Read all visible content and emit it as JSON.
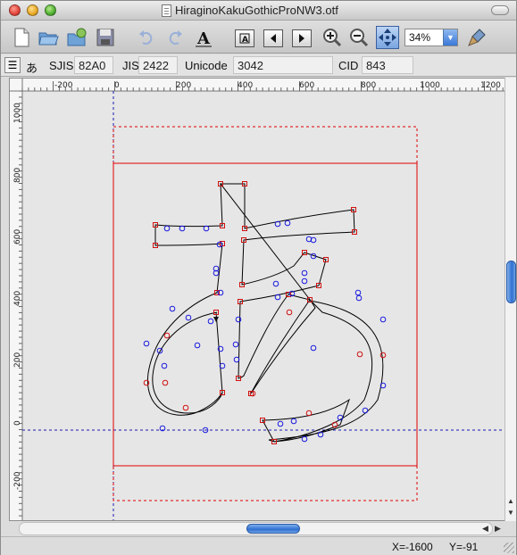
{
  "window": {
    "title": "HiraginoKakuGothicProNW3.otf"
  },
  "toolbar": {
    "zoom_value": "34%",
    "icons": [
      "new-document-icon",
      "open-folder-icon",
      "open-recent-icon",
      "save-disk-icon",
      "undo-icon",
      "redo-icon",
      "text-tool-icon",
      "glyph-lookup-icon",
      "previous-glyph-icon",
      "next-glyph-icon",
      "zoom-in-icon",
      "zoom-out-icon",
      "fit-view-icon",
      "zoom-dropdown-icon",
      "clean-brush-icon"
    ]
  },
  "glyph_info": {
    "char": "あ",
    "sjis_label": "SJIS",
    "sjis_value": "82A0",
    "jis_label": "JIS",
    "jis_value": "2422",
    "unicode_label": "Unicode",
    "unicode_value": "3042",
    "cid_label": "CID",
    "cid_value": "843"
  },
  "ruler": {
    "h_ticks": [
      "-200",
      "0",
      "200",
      "400",
      "600",
      "800",
      "1000",
      "1200"
    ],
    "v_ticks": [
      "1000",
      "800",
      "600",
      "400",
      "200",
      "0",
      "-200"
    ]
  },
  "status": {
    "x": "X=-1600",
    "y": "Y=-91"
  },
  "colors": {
    "outline": "#000000",
    "on_curve": "#d01010",
    "off_curve": "#1a1ae0",
    "frame": "#e00000",
    "baseline": "#1a1ab0"
  }
}
